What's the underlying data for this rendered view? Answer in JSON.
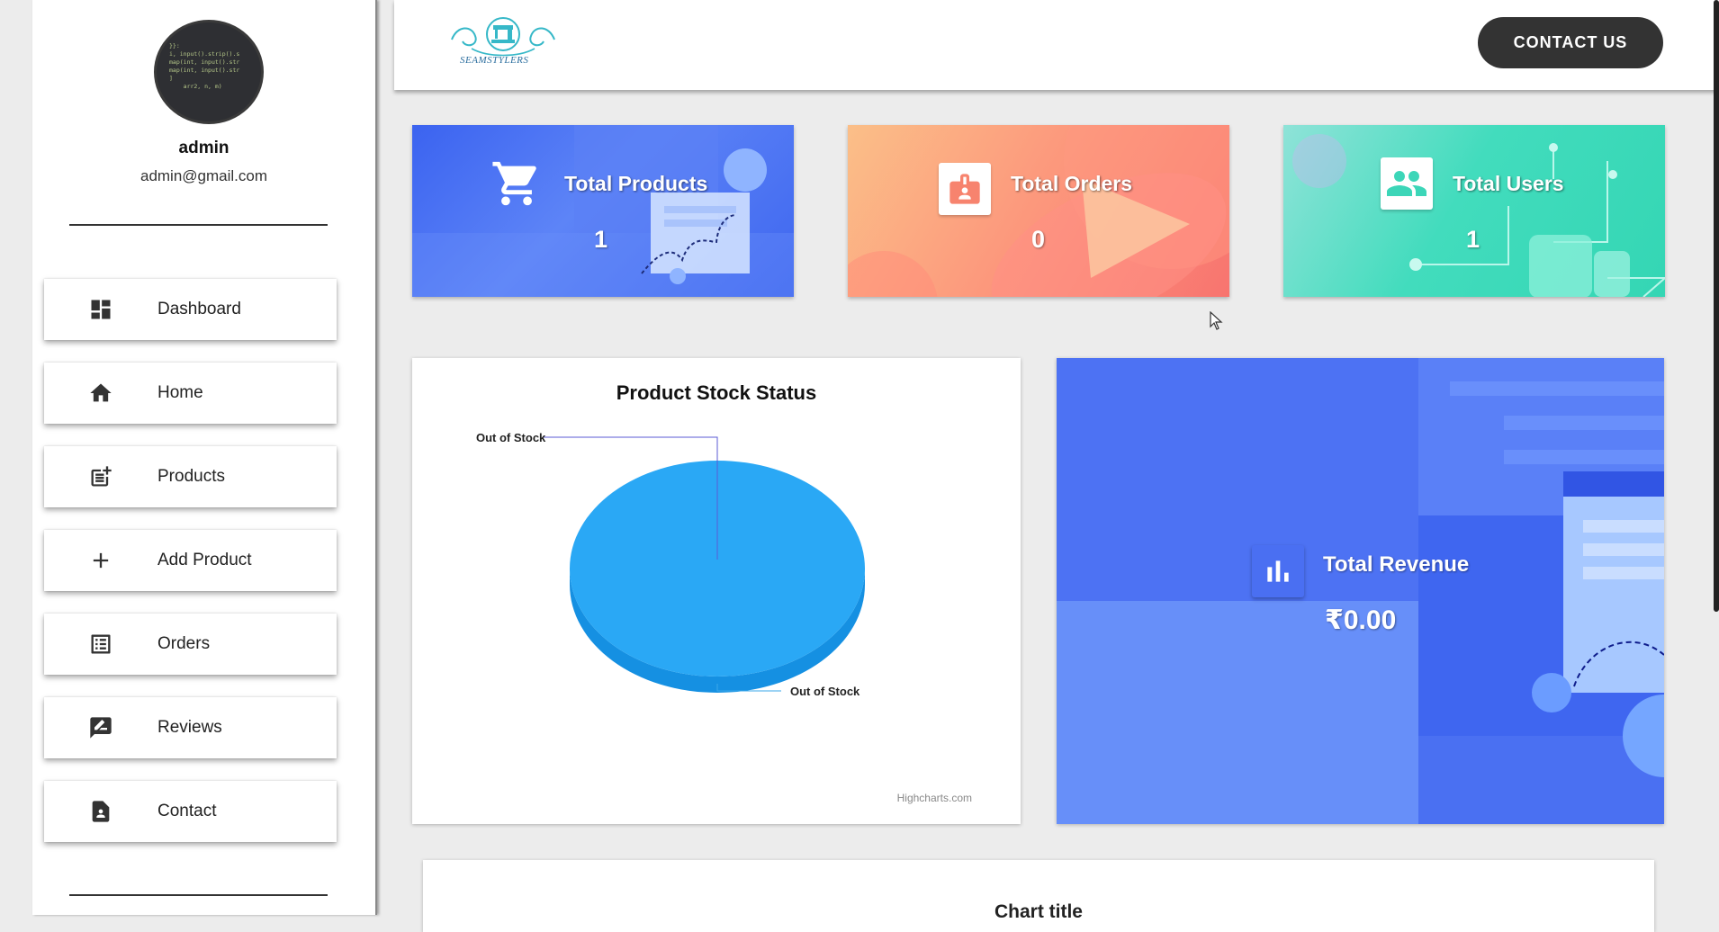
{
  "sidebar": {
    "profile": {
      "name": "admin",
      "email": "admin@gmail.com"
    },
    "items": [
      {
        "label": "Dashboard",
        "icon": "dashboard-icon"
      },
      {
        "label": "Home",
        "icon": "home-icon"
      },
      {
        "label": "Products",
        "icon": "post-add-icon"
      },
      {
        "label": "Add Product",
        "icon": "plus-icon"
      },
      {
        "label": "Orders",
        "icon": "list-icon"
      },
      {
        "label": "Reviews",
        "icon": "rate-review-icon"
      },
      {
        "label": "Contact",
        "icon": "contact-page-icon"
      }
    ]
  },
  "header": {
    "logo_text": "SEAMSTYLERS",
    "contact_label": "CONTACT US"
  },
  "stats": [
    {
      "title": "Total Products",
      "value": "1",
      "icon": "cart-icon"
    },
    {
      "title": "Total Orders",
      "value": "0",
      "icon": "badge-icon"
    },
    {
      "title": "Total Users",
      "value": "1",
      "icon": "users-icon"
    }
  ],
  "chart_data": {
    "type": "pie",
    "title": "Product Stock Status",
    "slices": [
      {
        "label": "Out of Stock",
        "value": 0
      },
      {
        "label": "Out of Stock",
        "value": 100
      }
    ],
    "credit": "Highcharts.com",
    "color": "#2aa8f5"
  },
  "revenue": {
    "title": "Total Revenue",
    "value": "₹0.00",
    "icon": "bar-chart-icon"
  },
  "bottom_chart": {
    "title": "Chart title"
  },
  "colors": {
    "products_card": "#3f6df0",
    "orders_card": "#fb8f7c",
    "users_card": "#3fdbbb",
    "revenue_card": "#4a72f2",
    "contact_button": "#333333"
  }
}
